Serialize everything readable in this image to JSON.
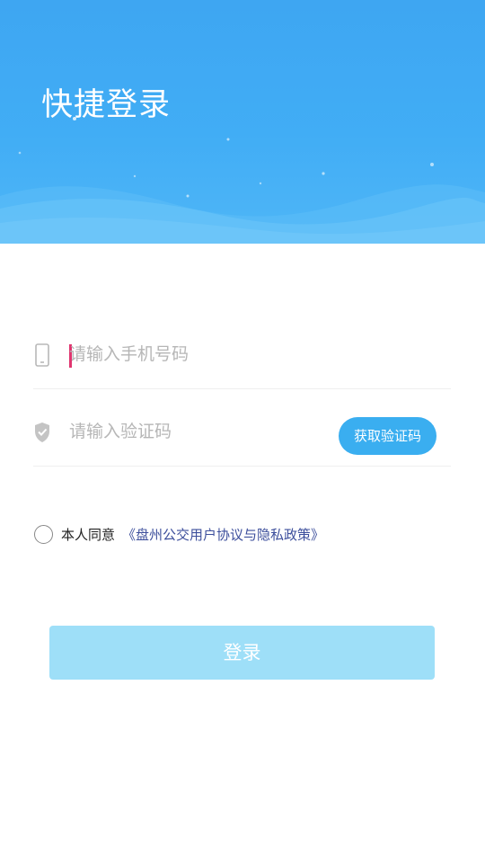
{
  "header": {
    "title": "快捷登录"
  },
  "form": {
    "phone_placeholder": "请输入手机号码",
    "code_placeholder": "请输入验证码",
    "get_code_label": "获取验证码"
  },
  "agreement": {
    "text": "本人同意",
    "link": "《盘州公交用户协议与隐私政策》",
    "checked": false
  },
  "login_button": {
    "label": "登录"
  },
  "colors": {
    "header_blue": "#41adf5",
    "button_blue": "#3aaef0",
    "login_disabled": "#9edff8",
    "link": "#3d4f9c",
    "caret": "#e0356f"
  },
  "icons": {
    "phone": "phone-icon",
    "code": "shield-check-icon"
  }
}
